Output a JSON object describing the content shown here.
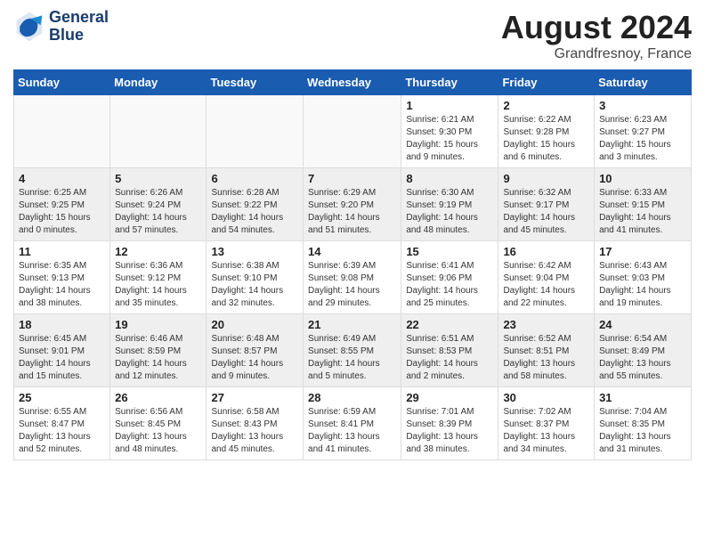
{
  "header": {
    "logo_line1": "General",
    "logo_line2": "Blue",
    "month_year": "August 2024",
    "location": "Grandfresnoy, France"
  },
  "weekdays": [
    "Sunday",
    "Monday",
    "Tuesday",
    "Wednesday",
    "Thursday",
    "Friday",
    "Saturday"
  ],
  "weeks": [
    [
      {
        "day": "",
        "info": ""
      },
      {
        "day": "",
        "info": ""
      },
      {
        "day": "",
        "info": ""
      },
      {
        "day": "",
        "info": ""
      },
      {
        "day": "1",
        "info": "Sunrise: 6:21 AM\nSunset: 9:30 PM\nDaylight: 15 hours\nand 9 minutes."
      },
      {
        "day": "2",
        "info": "Sunrise: 6:22 AM\nSunset: 9:28 PM\nDaylight: 15 hours\nand 6 minutes."
      },
      {
        "day": "3",
        "info": "Sunrise: 6:23 AM\nSunset: 9:27 PM\nDaylight: 15 hours\nand 3 minutes."
      }
    ],
    [
      {
        "day": "4",
        "info": "Sunrise: 6:25 AM\nSunset: 9:25 PM\nDaylight: 15 hours\nand 0 minutes."
      },
      {
        "day": "5",
        "info": "Sunrise: 6:26 AM\nSunset: 9:24 PM\nDaylight: 14 hours\nand 57 minutes."
      },
      {
        "day": "6",
        "info": "Sunrise: 6:28 AM\nSunset: 9:22 PM\nDaylight: 14 hours\nand 54 minutes."
      },
      {
        "day": "7",
        "info": "Sunrise: 6:29 AM\nSunset: 9:20 PM\nDaylight: 14 hours\nand 51 minutes."
      },
      {
        "day": "8",
        "info": "Sunrise: 6:30 AM\nSunset: 9:19 PM\nDaylight: 14 hours\nand 48 minutes."
      },
      {
        "day": "9",
        "info": "Sunrise: 6:32 AM\nSunset: 9:17 PM\nDaylight: 14 hours\nand 45 minutes."
      },
      {
        "day": "10",
        "info": "Sunrise: 6:33 AM\nSunset: 9:15 PM\nDaylight: 14 hours\nand 41 minutes."
      }
    ],
    [
      {
        "day": "11",
        "info": "Sunrise: 6:35 AM\nSunset: 9:13 PM\nDaylight: 14 hours\nand 38 minutes."
      },
      {
        "day": "12",
        "info": "Sunrise: 6:36 AM\nSunset: 9:12 PM\nDaylight: 14 hours\nand 35 minutes."
      },
      {
        "day": "13",
        "info": "Sunrise: 6:38 AM\nSunset: 9:10 PM\nDaylight: 14 hours\nand 32 minutes."
      },
      {
        "day": "14",
        "info": "Sunrise: 6:39 AM\nSunset: 9:08 PM\nDaylight: 14 hours\nand 29 minutes."
      },
      {
        "day": "15",
        "info": "Sunrise: 6:41 AM\nSunset: 9:06 PM\nDaylight: 14 hours\nand 25 minutes."
      },
      {
        "day": "16",
        "info": "Sunrise: 6:42 AM\nSunset: 9:04 PM\nDaylight: 14 hours\nand 22 minutes."
      },
      {
        "day": "17",
        "info": "Sunrise: 6:43 AM\nSunset: 9:03 PM\nDaylight: 14 hours\nand 19 minutes."
      }
    ],
    [
      {
        "day": "18",
        "info": "Sunrise: 6:45 AM\nSunset: 9:01 PM\nDaylight: 14 hours\nand 15 minutes."
      },
      {
        "day": "19",
        "info": "Sunrise: 6:46 AM\nSunset: 8:59 PM\nDaylight: 14 hours\nand 12 minutes."
      },
      {
        "day": "20",
        "info": "Sunrise: 6:48 AM\nSunset: 8:57 PM\nDaylight: 14 hours\nand 9 minutes."
      },
      {
        "day": "21",
        "info": "Sunrise: 6:49 AM\nSunset: 8:55 PM\nDaylight: 14 hours\nand 5 minutes."
      },
      {
        "day": "22",
        "info": "Sunrise: 6:51 AM\nSunset: 8:53 PM\nDaylight: 14 hours\nand 2 minutes."
      },
      {
        "day": "23",
        "info": "Sunrise: 6:52 AM\nSunset: 8:51 PM\nDaylight: 13 hours\nand 58 minutes."
      },
      {
        "day": "24",
        "info": "Sunrise: 6:54 AM\nSunset: 8:49 PM\nDaylight: 13 hours\nand 55 minutes."
      }
    ],
    [
      {
        "day": "25",
        "info": "Sunrise: 6:55 AM\nSunset: 8:47 PM\nDaylight: 13 hours\nand 52 minutes."
      },
      {
        "day": "26",
        "info": "Sunrise: 6:56 AM\nSunset: 8:45 PM\nDaylight: 13 hours\nand 48 minutes."
      },
      {
        "day": "27",
        "info": "Sunrise: 6:58 AM\nSunset: 8:43 PM\nDaylight: 13 hours\nand 45 minutes."
      },
      {
        "day": "28",
        "info": "Sunrise: 6:59 AM\nSunset: 8:41 PM\nDaylight: 13 hours\nand 41 minutes."
      },
      {
        "day": "29",
        "info": "Sunrise: 7:01 AM\nSunset: 8:39 PM\nDaylight: 13 hours\nand 38 minutes."
      },
      {
        "day": "30",
        "info": "Sunrise: 7:02 AM\nSunset: 8:37 PM\nDaylight: 13 hours\nand 34 minutes."
      },
      {
        "day": "31",
        "info": "Sunrise: 7:04 AM\nSunset: 8:35 PM\nDaylight: 13 hours\nand 31 minutes."
      }
    ]
  ]
}
